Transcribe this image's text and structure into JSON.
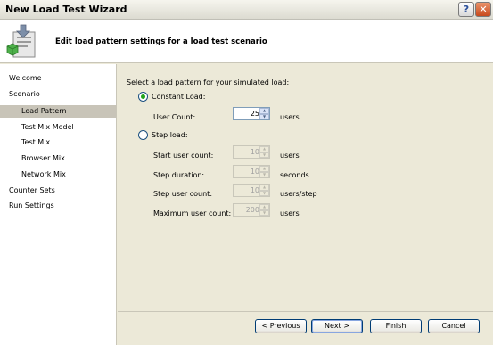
{
  "window": {
    "title": "New Load Test Wizard",
    "help_label": "?",
    "close_label": "✕"
  },
  "header": {
    "title": "Edit load pattern settings for a load test scenario",
    "icon": "wizard-document-icon"
  },
  "sidebar": {
    "items": [
      {
        "label": "Welcome"
      },
      {
        "label": "Scenario"
      },
      {
        "label": "Load Pattern",
        "selected": true
      },
      {
        "label": "Test Mix Model"
      },
      {
        "label": "Test Mix"
      },
      {
        "label": "Browser Mix"
      },
      {
        "label": "Network Mix"
      },
      {
        "label": "Counter Sets"
      },
      {
        "label": "Run Settings"
      }
    ]
  },
  "main": {
    "intro": "Select a load pattern for your simulated load:",
    "constant": {
      "label": "Constant Load:",
      "selected": true,
      "user_count_label": "User Count:",
      "user_count_value": "25",
      "user_count_unit": "users"
    },
    "step": {
      "label": "Step load:",
      "selected": false,
      "fields": [
        {
          "label": "Start user count:",
          "value": "10",
          "unit": "users"
        },
        {
          "label": "Step duration:",
          "value": "10",
          "unit": "seconds"
        },
        {
          "label": "Step user count:",
          "value": "10",
          "unit": "users/step"
        },
        {
          "label": "Maximum user count:",
          "value": "200",
          "unit": "users"
        }
      ]
    }
  },
  "footer": {
    "previous": "< Previous",
    "next": "Next >",
    "finish": "Finish",
    "cancel": "Cancel"
  },
  "colors": {
    "selection": "#c8c4b8",
    "radio_dot": "#22a41c",
    "panel": "#ece9d8"
  }
}
